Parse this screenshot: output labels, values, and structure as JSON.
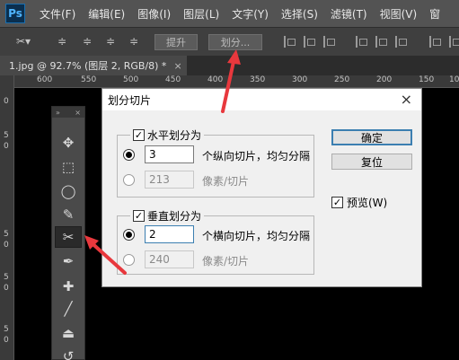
{
  "app": {
    "logo": "Ps"
  },
  "menu": [
    "文件(F)",
    "编辑(E)",
    "图像(I)",
    "图层(L)",
    "文字(Y)",
    "选择(S)",
    "滤镜(T)",
    "视图(V)",
    "窗"
  ],
  "options": {
    "promote_label": "提升",
    "divide_label": "划分..."
  },
  "document": {
    "tab_title": "1.jpg @ 92.7% (图层 2, RGB/8) *",
    "close": "×"
  },
  "ruler": {
    "top": [
      "600",
      "550",
      "500",
      "450",
      "400",
      "350",
      "300",
      "250",
      "200",
      "150",
      "100"
    ],
    "left": [
      "0",
      "5",
      "0",
      "5",
      "0",
      "5",
      "0",
      "5",
      "0"
    ]
  },
  "icons": {
    "slice_tool": "slice-icon",
    "move": "move-icon",
    "marquee": "marquee-icon",
    "lasso": "lasso-icon",
    "quick_select": "quick-select-icon",
    "slice": "slice-icon",
    "eyedropper": "eyedropper-icon",
    "healing": "healing-icon",
    "brush": "brush-icon",
    "stamp": "stamp-icon",
    "history_brush": "history-brush-icon"
  },
  "dialog": {
    "title": "划分切片",
    "close": "×",
    "horizontal": {
      "enabled": true,
      "label": "水平划分为",
      "count_value": "3",
      "count_hint": "个纵向切片，均匀分隔",
      "pixel_value": "213",
      "pixel_hint": "像素/切片"
    },
    "vertical": {
      "enabled": true,
      "label": "垂直划分为",
      "count_value": "2",
      "count_hint": "个横向切片，均匀分隔",
      "pixel_value": "240",
      "pixel_hint": "像素/切片"
    },
    "ok_label": "确定",
    "reset_label": "复位",
    "preview_label": "预览(W)",
    "preview_checked": true
  },
  "colors": {
    "annotation_arrow": "#e8383d",
    "focus_blue": "#3c7fb1"
  }
}
